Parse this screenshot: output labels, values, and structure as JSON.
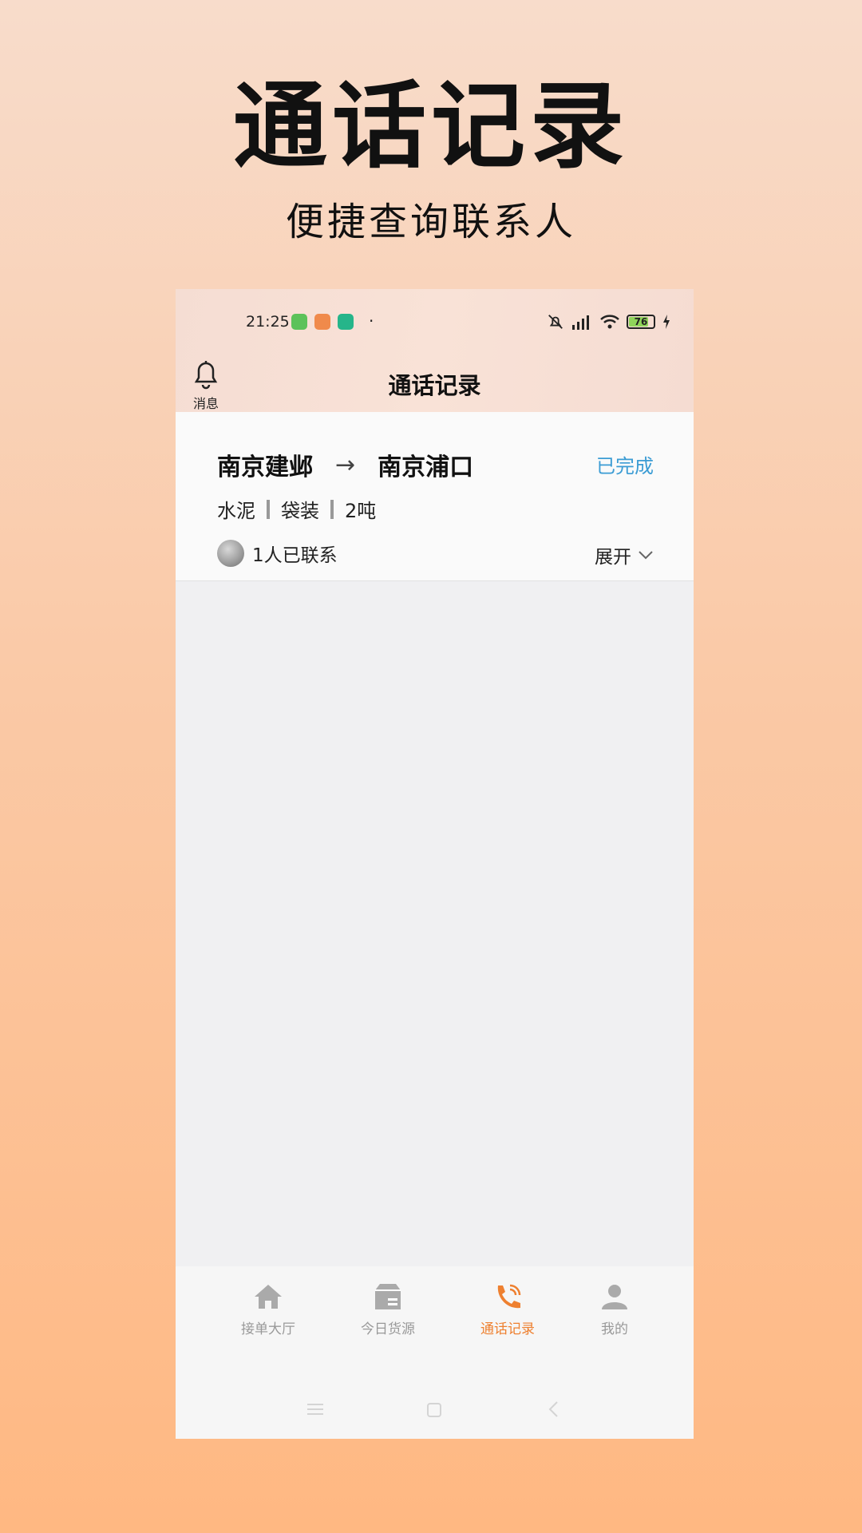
{
  "promo": {
    "title": "通话记录",
    "subtitle": "便捷查询联系人"
  },
  "statusbar": {
    "time": "21:25",
    "battery": "76",
    "dot": "·"
  },
  "header": {
    "message_label": "消息",
    "title": "通话记录"
  },
  "card": {
    "from": "南京建邺",
    "arrow": "→",
    "to": "南京浦口",
    "status": "已完成",
    "tags": [
      "水泥",
      "袋装",
      "2吨"
    ],
    "contact_text": "1人已联系",
    "expand_label": "展开"
  },
  "tabbar": {
    "items": [
      {
        "label": "接单大厅",
        "icon": "home-icon"
      },
      {
        "label": "今日货源",
        "icon": "box-icon"
      },
      {
        "label": "通话记录",
        "icon": "phone-icon"
      },
      {
        "label": "我的",
        "icon": "user-icon"
      }
    ],
    "active_index": 2
  },
  "colors": {
    "accent": "#ee8030",
    "status_done": "#3b9cd4",
    "tab_inactive": "#999999"
  }
}
